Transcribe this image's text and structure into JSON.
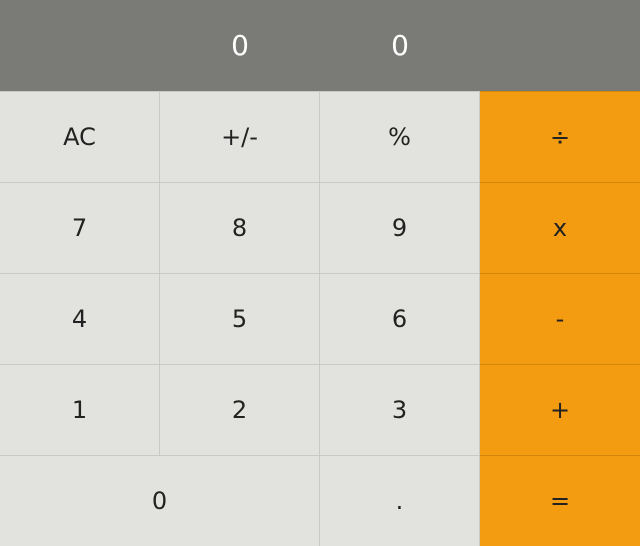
{
  "display": {
    "left": "0",
    "right": "0"
  },
  "keys": {
    "ac": "AC",
    "sign": "+/-",
    "percent": "%",
    "divide": "÷",
    "d7": "7",
    "d8": "8",
    "d9": "9",
    "multiply": "x",
    "d4": "4",
    "d5": "5",
    "d6": "6",
    "minus": "-",
    "d1": "1",
    "d2": "2",
    "d3": "3",
    "plus": "+",
    "d0": "0",
    "decimal": ".",
    "equals": "="
  }
}
